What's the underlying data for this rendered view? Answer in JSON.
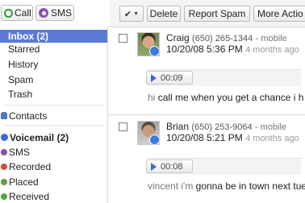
{
  "top_buttons": {
    "call_label": "Call",
    "sms_label": "SMS"
  },
  "toolbar": {
    "delete_label": "Delete",
    "spam_label": "Report Spam",
    "more_label": "More Actio"
  },
  "sidebar": {
    "items": [
      {
        "label": "Inbox (2)"
      },
      {
        "label": "Starred"
      },
      {
        "label": "History"
      },
      {
        "label": "Spam"
      },
      {
        "label": "Trash"
      },
      {
        "label": "Contacts"
      },
      {
        "label": "Voicemail (2)"
      },
      {
        "label": "SMS"
      },
      {
        "label": "Recorded"
      },
      {
        "label": "Placed"
      },
      {
        "label": "Received"
      }
    ]
  },
  "messages": [
    {
      "name": "Craig",
      "number": "(650) 265-1344",
      "type": "- mobile",
      "datetime": "10/20/08 5:36 PM",
      "ago": "4 months ago",
      "duration": "00:09",
      "transcript_muted": "hi",
      "transcript": "call me when you get a chance i h"
    },
    {
      "name": "Brian",
      "number": "(650) 253-9064",
      "type": "- mobile",
      "datetime": "10/20/08 5:21 PM",
      "ago": "4 months ago",
      "duration": "00:08",
      "transcript_muted": "vincent i'm",
      "transcript": "gonna be in town next tues"
    }
  ],
  "colors": {
    "selected_bg": "#5b7bd5",
    "sidebar_border": "#cfd9ea",
    "call_green": "#2a9a3a",
    "sms_purple": "#8b50b5",
    "voicemail_blue": "#3a6bd5"
  }
}
